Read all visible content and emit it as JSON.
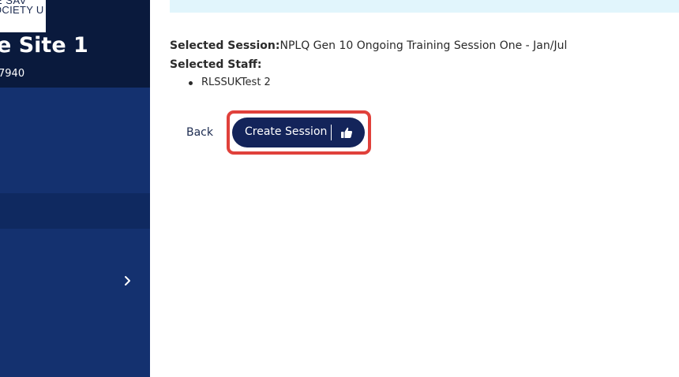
{
  "sidebar": {
    "logo_text_line1": "E SAV",
    "logo_text_line2": "OCIETY U",
    "site_title": "e Site 1",
    "site_code": "7940",
    "chevron_icon": "chevron-right-icon"
  },
  "main": {
    "selected_session_label": "Selected Session:",
    "selected_session_value": "NPLQ Gen 10 Ongoing Training Session One - Jan/Jul",
    "selected_staff_label": "Selected Staff:",
    "staff": [
      "RLSSUKTest 2"
    ],
    "back_label": "Back",
    "create_label": "Create Session",
    "create_icon": "thumbs-up-icon"
  },
  "colors": {
    "sidebar_bg": "#14316f",
    "sidebar_header_bg": "#0a1a3d",
    "banner_bg": "#e1f5fc",
    "button_bg": "#13245a",
    "highlight_border": "#e0413b"
  }
}
